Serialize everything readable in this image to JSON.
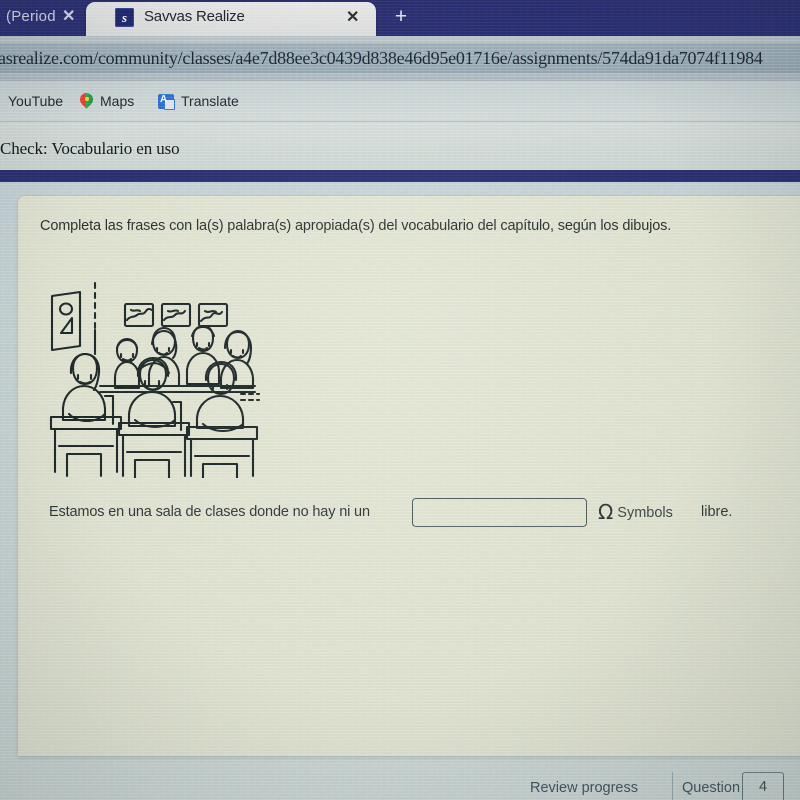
{
  "browser": {
    "tabs": [
      {
        "label": "(Period",
        "close_label": "✕",
        "active": false,
        "favicon": "none"
      },
      {
        "label": "Savvas Realize",
        "close_label": "✕",
        "active": true,
        "favicon": "savvas-s-icon"
      }
    ],
    "new_tab_label": "+",
    "url": "asrealize.com/community/classes/a4e7d88ee3c0439d838e46d95e01716e/assignments/574da91da7074f11984",
    "bookmarks": [
      {
        "label": "YouTube",
        "icon": "youtube-icon"
      },
      {
        "label": "Maps",
        "icon": "map-pin-icon"
      },
      {
        "label": "Translate",
        "icon": "translate-icon"
      }
    ]
  },
  "page": {
    "header_title": "Check: Vocabulario en uso",
    "instructions": "Completa las frases con la(s) palabra(s) apropiada(s) del vocabulario del capítulo, según los dibujos.",
    "illustration_alt": "classroom-line-drawing",
    "answer": {
      "prefix": "Estamos en una sala de clases donde no hay ni un",
      "input_value": "",
      "input_placeholder": "",
      "symbols_glyph": "Ω",
      "symbols_label": "Symbols",
      "suffix": "libre."
    }
  },
  "footer": {
    "review_progress_label": "Review progress",
    "question_label": "Question",
    "question_number": "4"
  },
  "colors": {
    "tabstrip": "#2b2f6e",
    "navy_band": "#2a2f6e",
    "card": "#dfe2cf",
    "surface": "#c6d2d4",
    "favicon": "#1f2a6b",
    "ink": "#26292b"
  }
}
